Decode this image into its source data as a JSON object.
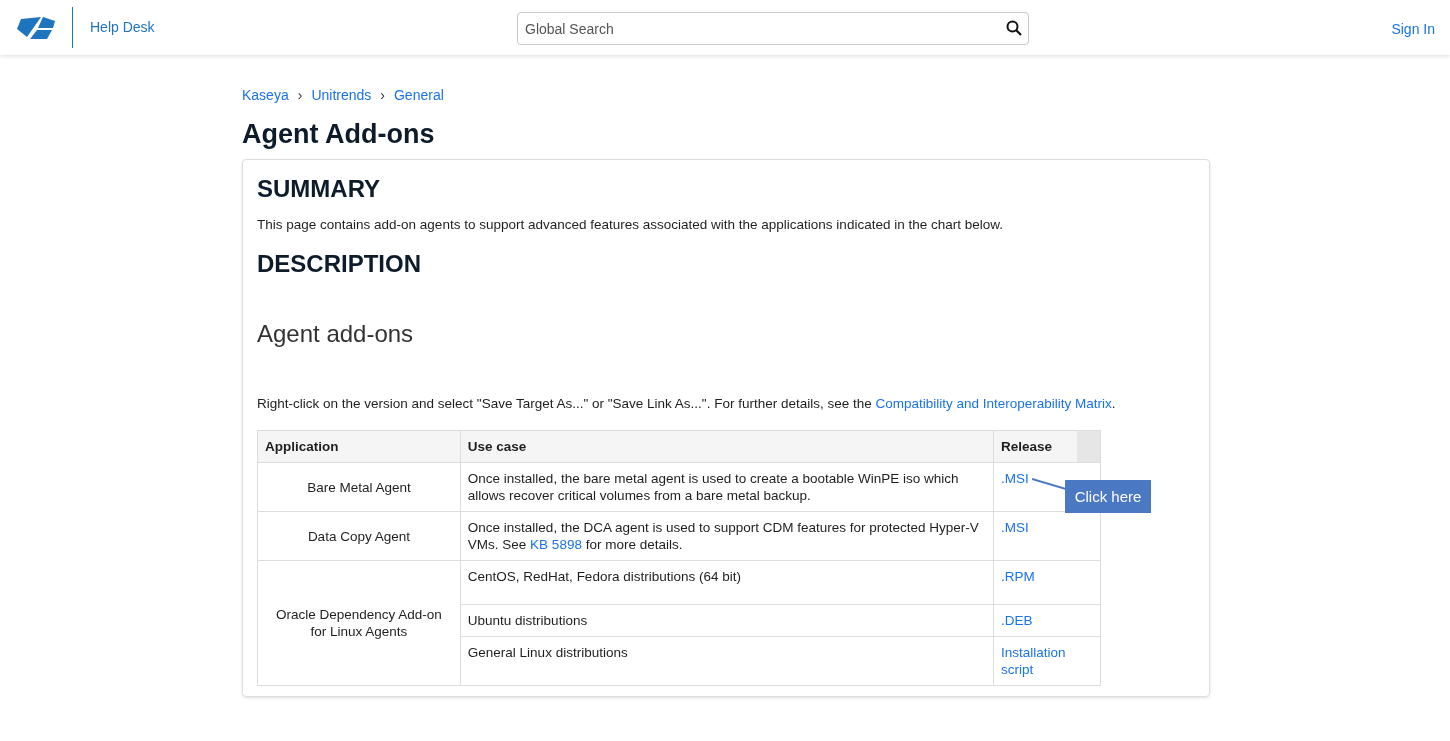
{
  "header": {
    "site_name": "Help Desk",
    "search": {
      "placeholder": "Global Search"
    },
    "sign_in": "Sign In"
  },
  "breadcrumbs": [
    "Kaseya",
    "Unitrends",
    "General"
  ],
  "breadcrumb_separator": "›",
  "title": "Agent Add-ons",
  "sections": [
    {
      "kind": "heading",
      "text": "SUMMARY"
    },
    {
      "kind": "paragraph",
      "parts": [
        {
          "kind": "text",
          "text": "This page contains add-on agents to support advanced features associated with the applications indicated in the chart below."
        }
      ]
    },
    {
      "kind": "heading",
      "text": "DESCRIPTION"
    },
    {
      "kind": "subheading",
      "text": "Agent add-ons"
    },
    {
      "kind": "paragraph",
      "parts": [
        {
          "kind": "text",
          "text": "Right-click on the version and select \"Save Target As...\" or \"Save Link As...\". For further details, see the "
        },
        {
          "kind": "link",
          "text": "Compatibility and Interoperability Matrix"
        },
        {
          "kind": "text",
          "text": "."
        }
      ]
    }
  ],
  "table": {
    "columns": [
      "Application",
      "Use case",
      "Release"
    ],
    "groups": [
      {
        "application": "Bare Metal Agent",
        "entries": [
          {
            "use_case": [
              {
                "kind": "text",
                "text": "Once installed, the bare metal agent is used to create a bootable WinPE iso which allows recover critical volumes from a bare metal backup."
              }
            ],
            "release": ".MSI",
            "callout": "Click here"
          }
        ]
      },
      {
        "application": "Data Copy Agent",
        "entries": [
          {
            "use_case": [
              {
                "kind": "text",
                "text": "Once installed, the DCA agent is used to support CDM features for protected Hyper-V VMs. See "
              },
              {
                "kind": "link",
                "text": "KB 5898"
              },
              {
                "kind": "text",
                "text": " for more details."
              }
            ],
            "release": ".MSI"
          }
        ]
      },
      {
        "application": "Oracle Dependency Add-on for Linux Agents",
        "entries": [
          {
            "use_case": [
              {
                "kind": "text",
                "text": "CentOS, RedHat, Fedora distributions (64 bit)"
              }
            ],
            "release": ".RPM",
            "tall": true
          },
          {
            "use_case": [
              {
                "kind": "text",
                "text": "Ubuntu distributions"
              }
            ],
            "release": ".DEB"
          },
          {
            "use_case": [
              {
                "kind": "text",
                "text": "General Linux distributions"
              }
            ],
            "release": "Installation script"
          }
        ]
      }
    ]
  }
}
